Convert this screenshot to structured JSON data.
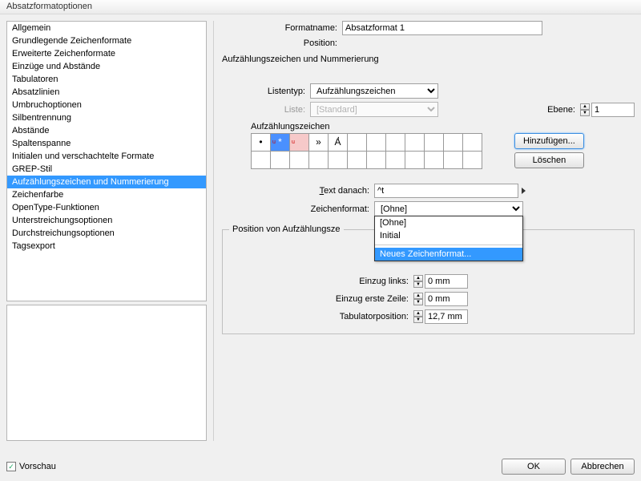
{
  "title": "Absatzformatoptionen",
  "nav": {
    "items": [
      "Allgemein",
      "Grundlegende Zeichenformate",
      "Erweiterte Zeichenformate",
      "Einzüge und Abstände",
      "Tabulatoren",
      "Absatzlinien",
      "Umbruchoptionen",
      "Silbentrennung",
      "Abstände",
      "Spaltenspanne",
      "Initialen und verschachtelte Formate",
      "GREP-Stil",
      "Aufzählungszeichen und Nummerierung",
      "Zeichenfarbe",
      "OpenType-Funktionen",
      "Unterstreichungsoptionen",
      "Durchstreichungsoptionen",
      "Tagsexport"
    ],
    "selected_index": 12
  },
  "header": {
    "formatname_label": "Formatname:",
    "formatname_value": "Absatzformat 1",
    "position_label": "Position:",
    "section_heading": "Aufzählungszeichen und Nummerierung"
  },
  "list_type": {
    "label": "Listentyp:",
    "value": "Aufzählungszeichen"
  },
  "list": {
    "label": "Liste:",
    "value": "[Standard]",
    "disabled": true
  },
  "level": {
    "label": "Ebene:",
    "value": "1"
  },
  "bullets": {
    "group_label": "Aufzählungszeichen",
    "glyphs": [
      "•",
      "*",
      "",
      "»",
      "A̛",
      "",
      "",
      "",
      "",
      "",
      "",
      "",
      "",
      "",
      "",
      "",
      "",
      "",
      "",
      "",
      "",
      "",
      "",
      ""
    ],
    "add_label": "Hinzufügen...",
    "delete_label": "Löschen"
  },
  "text_after": {
    "label": "Text danach:",
    "value": "^t"
  },
  "char_format": {
    "label": "Zeichenformat:",
    "value": "[Ohne]",
    "options": [
      "[Ohne]",
      "Initial"
    ],
    "new_label": "Neues Zeichenformat...",
    "hover_index": 2
  },
  "position_group": {
    "legend": "Position von Aufzählungsze",
    "indent_left_label": "Einzug links:",
    "indent_left_value": "0 mm",
    "first_line_label": "Einzug erste Zeile:",
    "first_line_value": "0 mm",
    "tab_pos_label": "Tabulatorposition:",
    "tab_pos_value": "12,7 mm"
  },
  "footer": {
    "preview_label": "Vorschau",
    "ok": "OK",
    "cancel": "Abbrechen"
  }
}
